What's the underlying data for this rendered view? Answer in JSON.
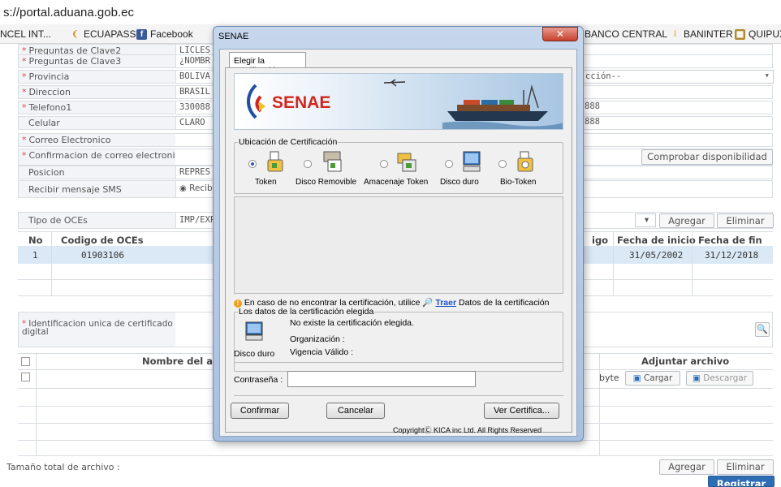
{
  "browser": {
    "url": "s://portal.aduana.gob.ec",
    "bookmarks": [
      "NCEL INT...",
      "ECUAPASS",
      "Facebook",
      "BANCO CENTRAL",
      "BANINTER",
      "QUIPUX"
    ]
  },
  "form": {
    "fields": [
      {
        "label": "Preguntas de Clave2",
        "value": "LICLES",
        "required": true
      },
      {
        "label": "Preguntas de Clave3",
        "value": "¿NOMBR",
        "required": true
      },
      {
        "label": "Provincia",
        "value": "BOLIVA",
        "required": true
      },
      {
        "label": "Direccion",
        "value": "BRASIL",
        "required": true
      },
      {
        "label": "Telefono1",
        "value": "330088",
        "required": true
      },
      {
        "label": "Celular",
        "value": "CLARO",
        "required": false
      },
      {
        "label": "Correo Electronico",
        "value": "",
        "required": true
      },
      {
        "label": "Confirmacion de correo electronico",
        "value": "",
        "required": true
      },
      {
        "label": "Posicion",
        "value": "REPRES",
        "required": false
      },
      {
        "label": "Recibir mensaje SMS",
        "value": "Recib",
        "required": false
      }
    ],
    "right_fragments": {
      "provincia_select": "cción--",
      "telefono_ext": "888",
      "celular_ext": "888"
    },
    "check_availability": "Comprobar disponibilidad",
    "oce_type_label": "Tipo de OCEs",
    "oce_type_value": "IMP/EXP",
    "oce_add": "Agregar",
    "oce_delete": "Eliminar",
    "oce_table": {
      "headers": [
        "No",
        "Codigo de OCEs",
        "igo",
        "Fecha de inicio",
        "Fecha de fin"
      ],
      "rows": [
        {
          "no": "1",
          "code": "01903106",
          "start": "31/05/2002",
          "end": "31/12/2018"
        }
      ]
    },
    "cert_id_label": "Identificacion unica de certificado digital",
    "file_table": {
      "headers": [
        "Nombre del ar",
        "Adjuntar archivo"
      ],
      "size_unit": "byte",
      "upload": "Cargar",
      "download": "Descargar"
    },
    "total_size_label": "Tamaño total de archivo :",
    "bottom_add": "Agregar",
    "bottom_delete": "Eliminar",
    "register": "Registrar"
  },
  "modal": {
    "title": "SENAE",
    "tab": "Elegir la Certificación",
    "brand": "SENAE",
    "location_legend": "Ubicación de Certificación",
    "options": [
      "Token",
      "Disco Removible",
      "Amacenaje Token",
      "Disco duro",
      "Bio-Token"
    ],
    "notice_prefix": "En caso de no encontrar la certificación, utilice",
    "notice_link": "Traer",
    "notice_suffix": "Datos de la certificación",
    "selected_legend": "Los datos de la certificación elegida",
    "selected_device": "Disco duro",
    "no_cert": "No existe la certificación elegida.",
    "organization": "Organización :",
    "validity": "Vigencia Válido :",
    "password_label": "Contraseña :",
    "confirm": "Confirmar",
    "cancel": "Cancelar",
    "view_cert": "Ver Certifica...",
    "copyright": "CopyrightⒸ KICA inc Ltd. All Rights Reserved"
  }
}
